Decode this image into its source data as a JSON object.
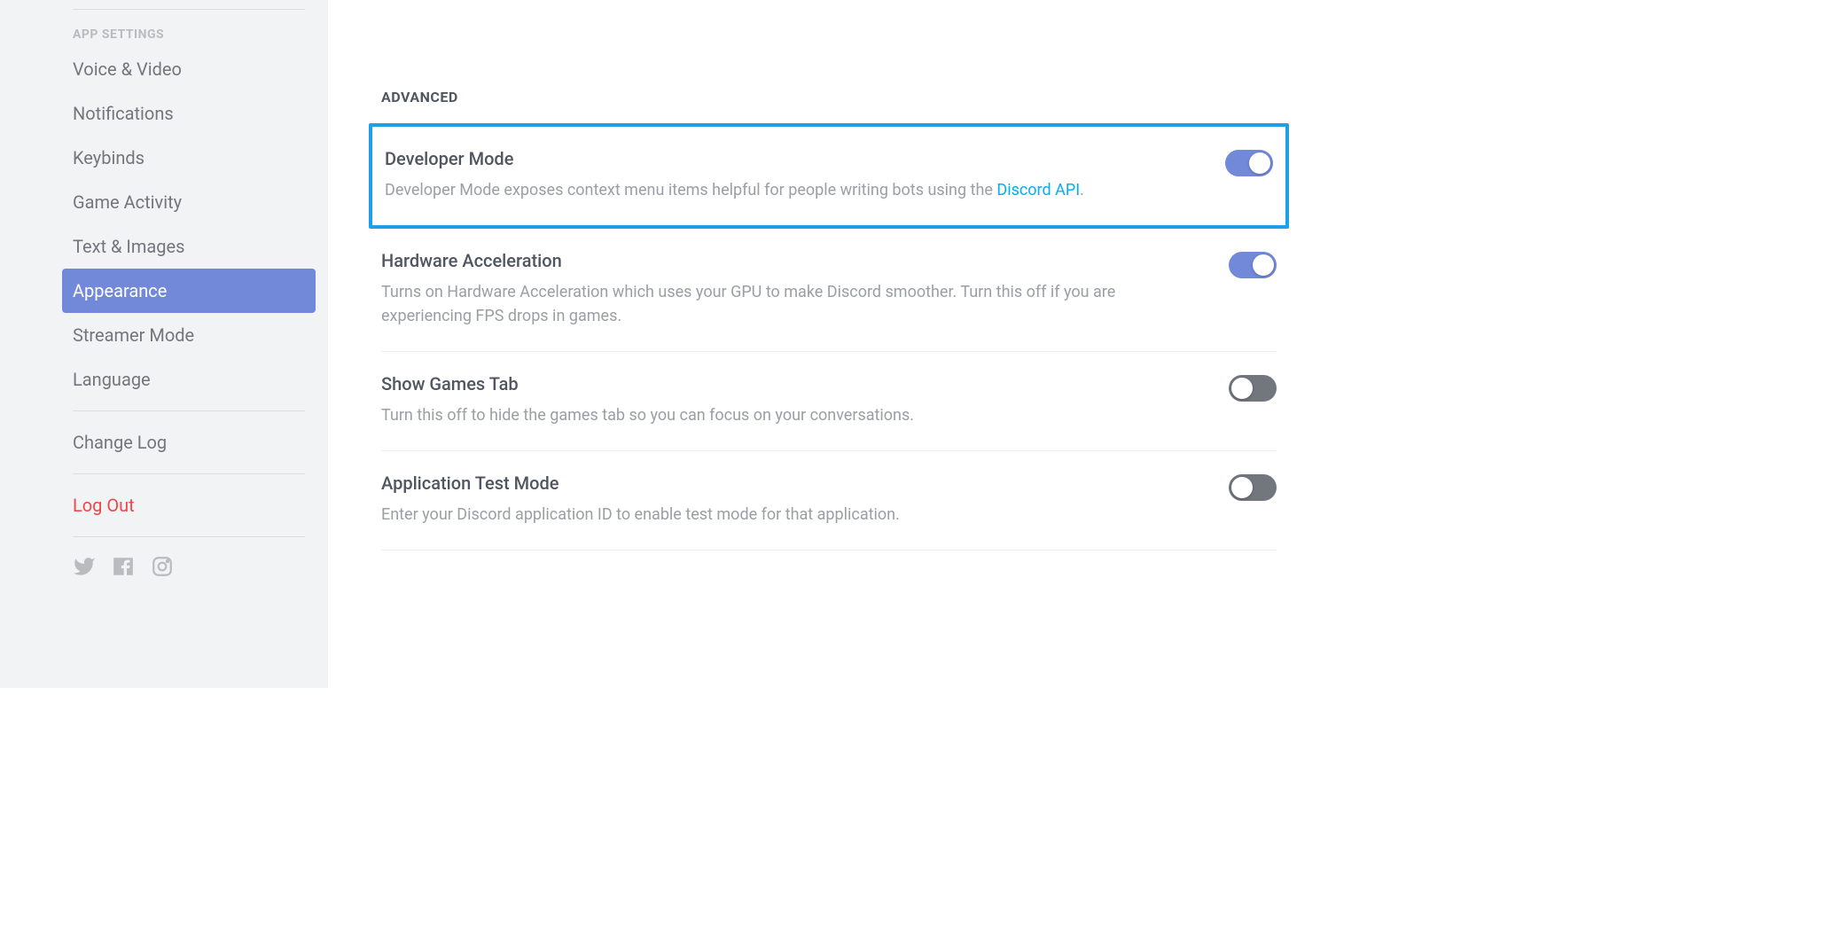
{
  "sidebar": {
    "section_header": "APP SETTINGS",
    "items": [
      {
        "label": "Voice & Video",
        "selected": false
      },
      {
        "label": "Notifications",
        "selected": false
      },
      {
        "label": "Keybinds",
        "selected": false
      },
      {
        "label": "Game Activity",
        "selected": false
      },
      {
        "label": "Text & Images",
        "selected": false
      },
      {
        "label": "Appearance",
        "selected": true
      },
      {
        "label": "Streamer Mode",
        "selected": false
      },
      {
        "label": "Language",
        "selected": false
      }
    ],
    "change_log": "Change Log",
    "log_out": "Log Out"
  },
  "main": {
    "section_header": "ADVANCED",
    "settings": [
      {
        "title": "Developer Mode",
        "description_prefix": "Developer Mode exposes context menu items helpful for people writing bots using the ",
        "link_text": "Discord API",
        "description_suffix": ".",
        "toggle": true,
        "highlighted": true
      },
      {
        "title": "Hardware Acceleration",
        "description": "Turns on Hardware Acceleration which uses your GPU to make Discord smoother. Turn this off if you are experiencing FPS drops in games.",
        "toggle": true,
        "highlighted": false
      },
      {
        "title": "Show Games Tab",
        "description": "Turn this off to hide the games tab so you can focus on your conversations.",
        "toggle": false,
        "highlighted": false
      },
      {
        "title": "Application Test Mode",
        "description": "Enter your Discord application ID to enable test mode for that application.",
        "toggle": false,
        "highlighted": false
      }
    ]
  },
  "colors": {
    "accent": "#7289da",
    "link": "#00aff4",
    "danger": "#f04747",
    "highlight_border": "#1e9fe8"
  }
}
